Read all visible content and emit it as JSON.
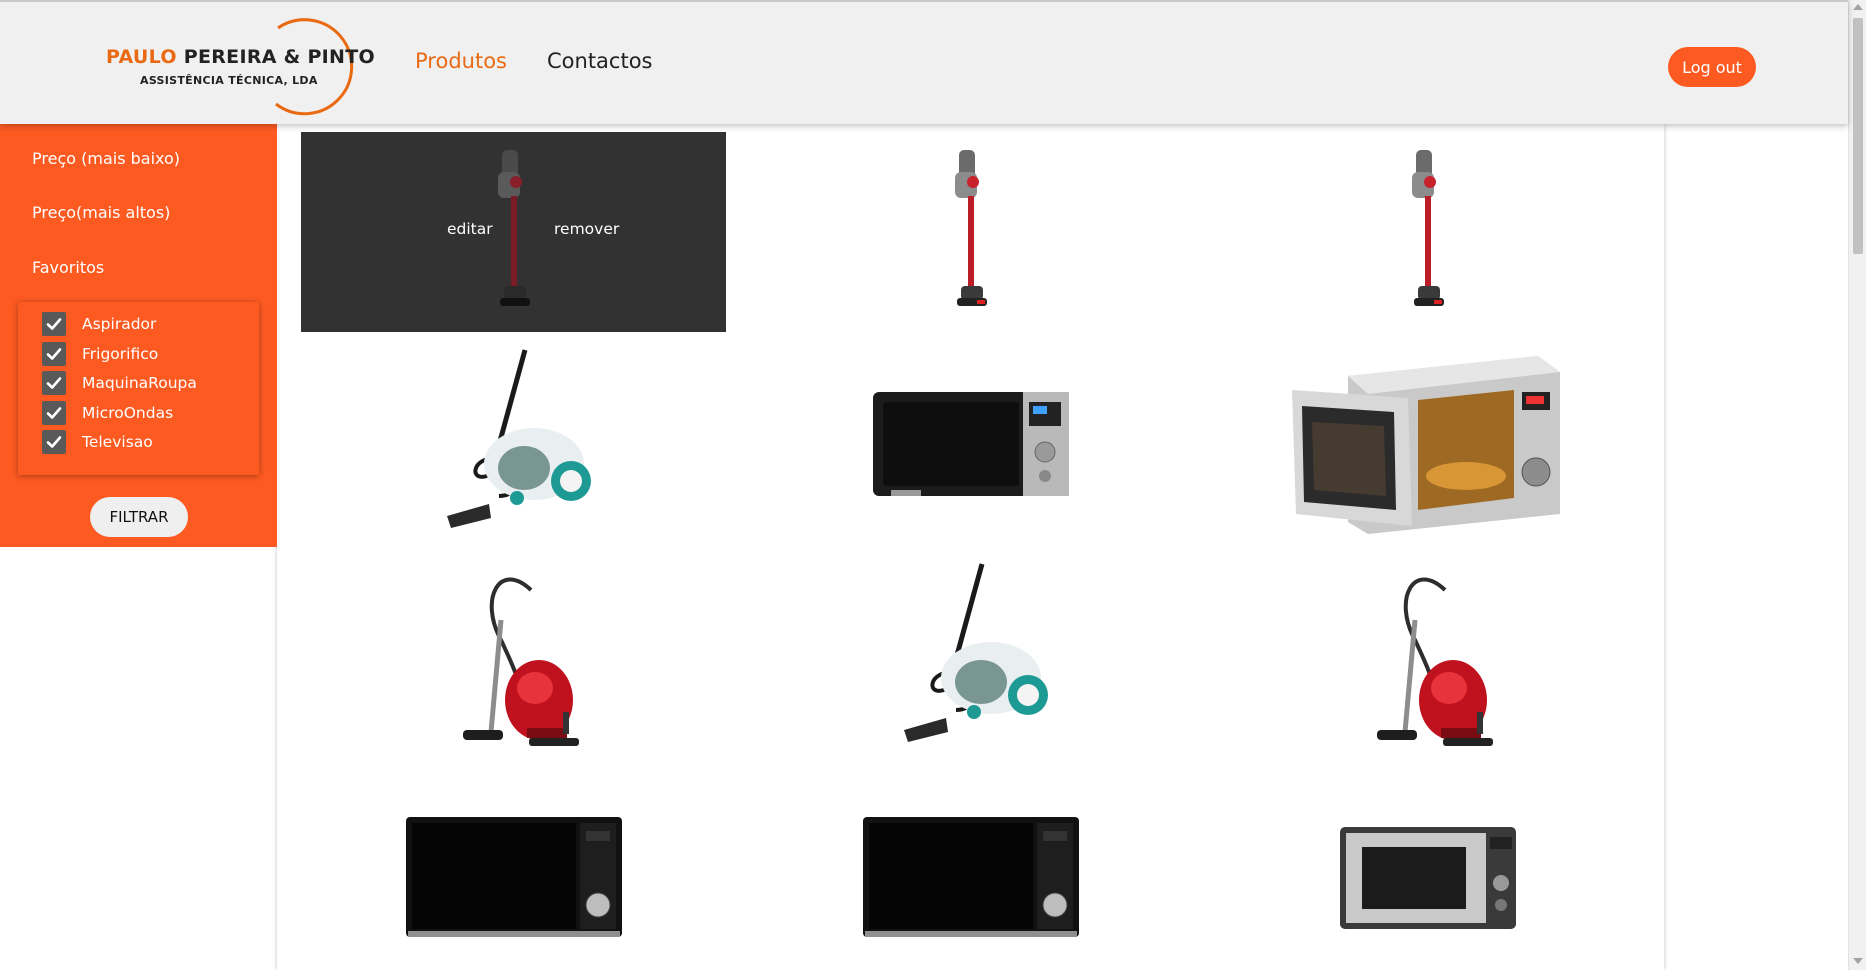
{
  "brand": {
    "name_part1": "PAULO",
    "name_part2": "PEREIRA & PINTO",
    "subtitle": "ASSISTÊNCIA TÉCNICA, LDA",
    "accent_color": "#ea6a14"
  },
  "nav": {
    "produtos": "Produtos",
    "contactos": "Contactos",
    "logout": "Log out"
  },
  "sidebar": {
    "sort_low": "Preço (mais baixo)",
    "sort_high": "Preço(mais altos)",
    "favorites": "Favoritos",
    "categories": [
      {
        "label": "Aspirador",
        "checked": true
      },
      {
        "label": "Frigorifico",
        "checked": true
      },
      {
        "label": "MaquinaRoupa",
        "checked": true
      },
      {
        "label": "MicroOndas",
        "checked": true
      },
      {
        "label": "Televisao",
        "checked": true
      }
    ],
    "filter_button": "FILTRAR",
    "bg_color": "#fd5a22"
  },
  "products": {
    "edit_label": "editar",
    "remove_label": "remover",
    "items": [
      {
        "kind": "stick-vacuum-icon",
        "hovered": true
      },
      {
        "kind": "stick-vacuum-icon"
      },
      {
        "kind": "stick-vacuum-icon"
      },
      {
        "kind": "cyclone-vacuum-icon"
      },
      {
        "kind": "microwave-icon"
      },
      {
        "kind": "microwave-open-icon"
      },
      {
        "kind": "canister-vacuum-icon"
      },
      {
        "kind": "cyclone-vacuum-icon"
      },
      {
        "kind": "canister-vacuum-icon"
      },
      {
        "kind": "microwave-black-icon"
      },
      {
        "kind": "microwave-black-icon"
      },
      {
        "kind": "microwave-silver-icon"
      }
    ]
  }
}
